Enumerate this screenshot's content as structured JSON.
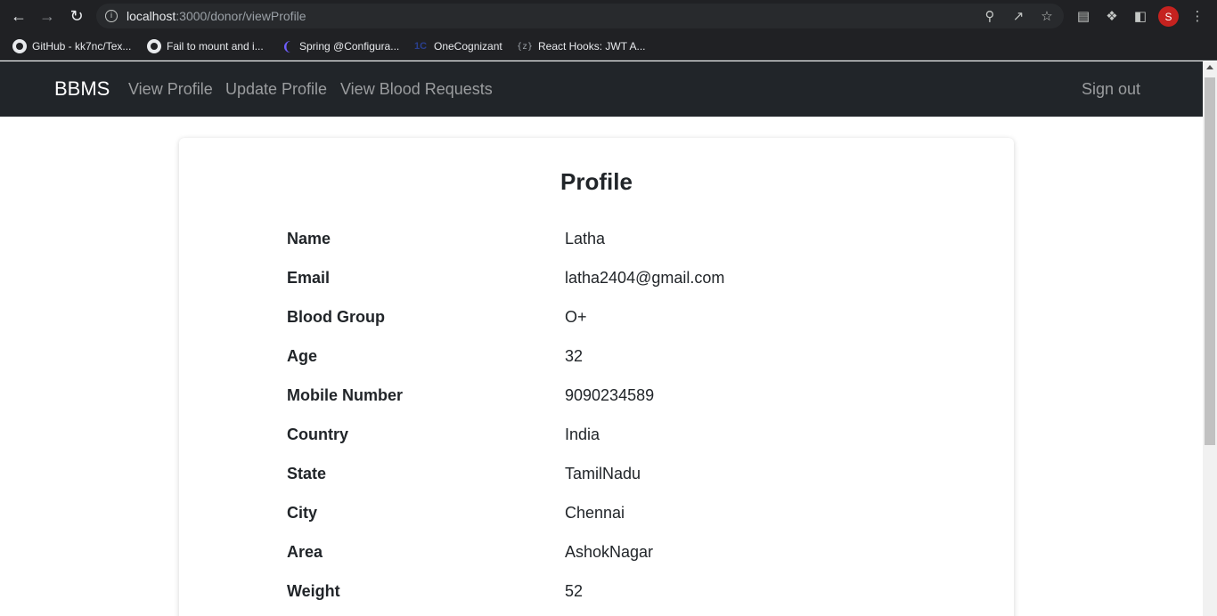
{
  "browser": {
    "url_host": "localhost",
    "url_path": ":3000/donor/viewProfile",
    "avatar_letter": "S",
    "bookmarks": [
      {
        "label": "GitHub - kk7nc/Tex...",
        "icon": "github-icon"
      },
      {
        "label": "Fail to mount and i...",
        "icon": "github-icon"
      },
      {
        "label": "Spring @Configura...",
        "icon": "spring-icon"
      },
      {
        "label": "OneCognizant",
        "icon": "onecognizant-icon"
      },
      {
        "label": "React Hooks: JWT A...",
        "icon": "code-brace-icon"
      }
    ]
  },
  "navbar": {
    "brand": "BBMS",
    "links": [
      "View Profile",
      "Update Profile",
      "View Blood Requests"
    ],
    "signout": "Sign out"
  },
  "profile": {
    "title": "Profile",
    "fields": [
      {
        "label": "Name",
        "value": "Latha"
      },
      {
        "label": "Email",
        "value": "latha2404@gmail.com"
      },
      {
        "label": "Blood Group",
        "value": "O+"
      },
      {
        "label": "Age",
        "value": "32"
      },
      {
        "label": "Mobile Number",
        "value": "9090234589"
      },
      {
        "label": "Country",
        "value": "India"
      },
      {
        "label": "State",
        "value": "TamilNadu"
      },
      {
        "label": "City",
        "value": "Chennai"
      },
      {
        "label": "Area",
        "value": "AshokNagar"
      },
      {
        "label": "Weight",
        "value": "52"
      }
    ]
  },
  "colors": {
    "navbar_bg": "#212529",
    "chrome_bg": "#202124",
    "avatar_bg": "#c5221f"
  }
}
